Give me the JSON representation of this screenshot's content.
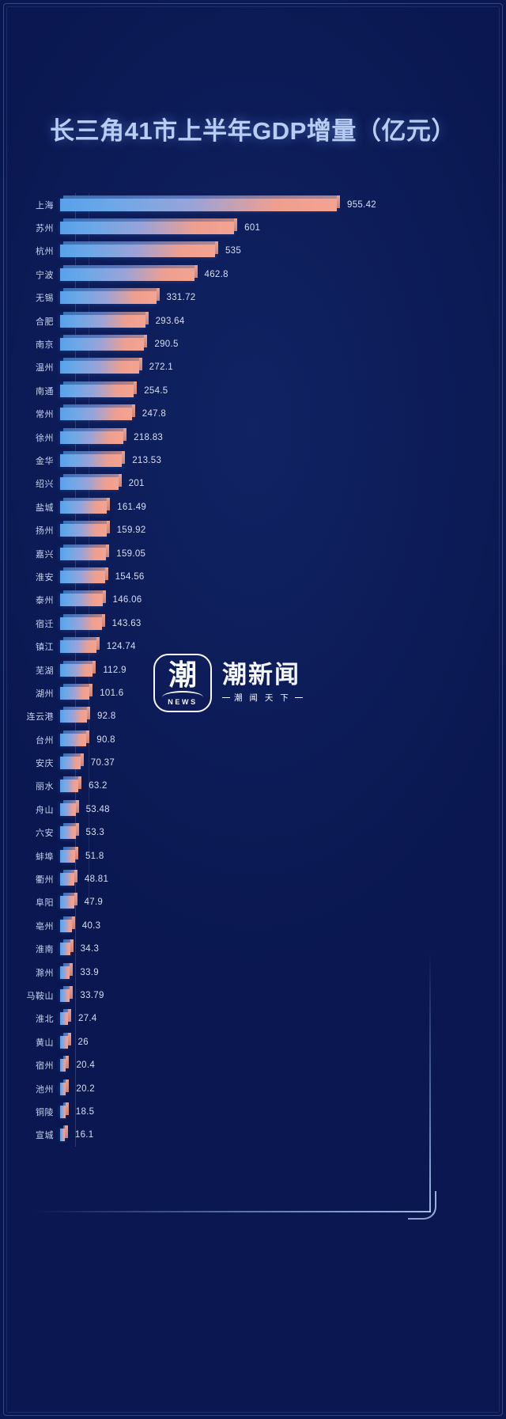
{
  "title": "长三角41市上半年GDP增量（亿元）",
  "colors": {
    "background": "#0a1750",
    "title": "#b9cdf2",
    "bar_start": "#58a1ea",
    "bar_end": "#f4a391",
    "label": "#c6d3ec",
    "value": "#d8dff0"
  },
  "watermark": {
    "glyph": "潮",
    "news": "NEWS",
    "brand": "潮新闻",
    "slogan_dash": "—",
    "slogan": "潮 闻 天 下"
  },
  "chart_data": {
    "type": "bar",
    "orientation": "horizontal",
    "title": "长三角41市上半年GDP增量（亿元）",
    "xlabel": "",
    "ylabel": "",
    "unit": "亿元",
    "grid": false,
    "legend": null,
    "xlim": [
      0,
      955.42
    ],
    "categories": [
      "上海",
      "苏州",
      "杭州",
      "宁波",
      "无锡",
      "合肥",
      "南京",
      "温州",
      "南通",
      "常州",
      "徐州",
      "金华",
      "绍兴",
      "盐城",
      "扬州",
      "嘉兴",
      "淮安",
      "泰州",
      "宿迁",
      "镇江",
      "芜湖",
      "湖州",
      "连云港",
      "台州",
      "安庆",
      "丽水",
      "舟山",
      "六安",
      "蚌埠",
      "衢州",
      "阜阳",
      "亳州",
      "淮南",
      "滁州",
      "马鞍山",
      "淮北",
      "黄山",
      "宿州",
      "池州",
      "铜陵",
      "宣城"
    ],
    "values": [
      955.42,
      601,
      535,
      462.8,
      331.72,
      293.64,
      290.5,
      272.1,
      254.5,
      247.8,
      218.83,
      213.53,
      201,
      161.49,
      159.92,
      159.05,
      154.56,
      146.06,
      143.63,
      124.74,
      112.9,
      101.6,
      92.8,
      90.8,
      70.37,
      63.2,
      53.48,
      53.3,
      51.8,
      48.81,
      47.9,
      40.3,
      34.3,
      33.9,
      33.79,
      27.4,
      26,
      20.4,
      20.2,
      18.5,
      16.1
    ],
    "value_labels": [
      "955.42",
      "601",
      "535",
      "462.8",
      "331.72",
      "293.64",
      "290.5",
      "272.1",
      "254.5",
      "247.8",
      "218.83",
      "213.53",
      "201",
      "161.49",
      "159.92",
      "159.05",
      "154.56",
      "146.06",
      "143.63",
      "124.74",
      "112.9",
      "101.6",
      "92.8",
      "90.8",
      "70.37",
      "63.2",
      "53.48",
      "53.3",
      "51.8",
      "48.81",
      "47.9",
      "40.3",
      "34.3",
      "33.9",
      "33.79",
      "27.4",
      "26",
      "20.4",
      "20.2",
      "18.5",
      "16.1"
    ]
  }
}
